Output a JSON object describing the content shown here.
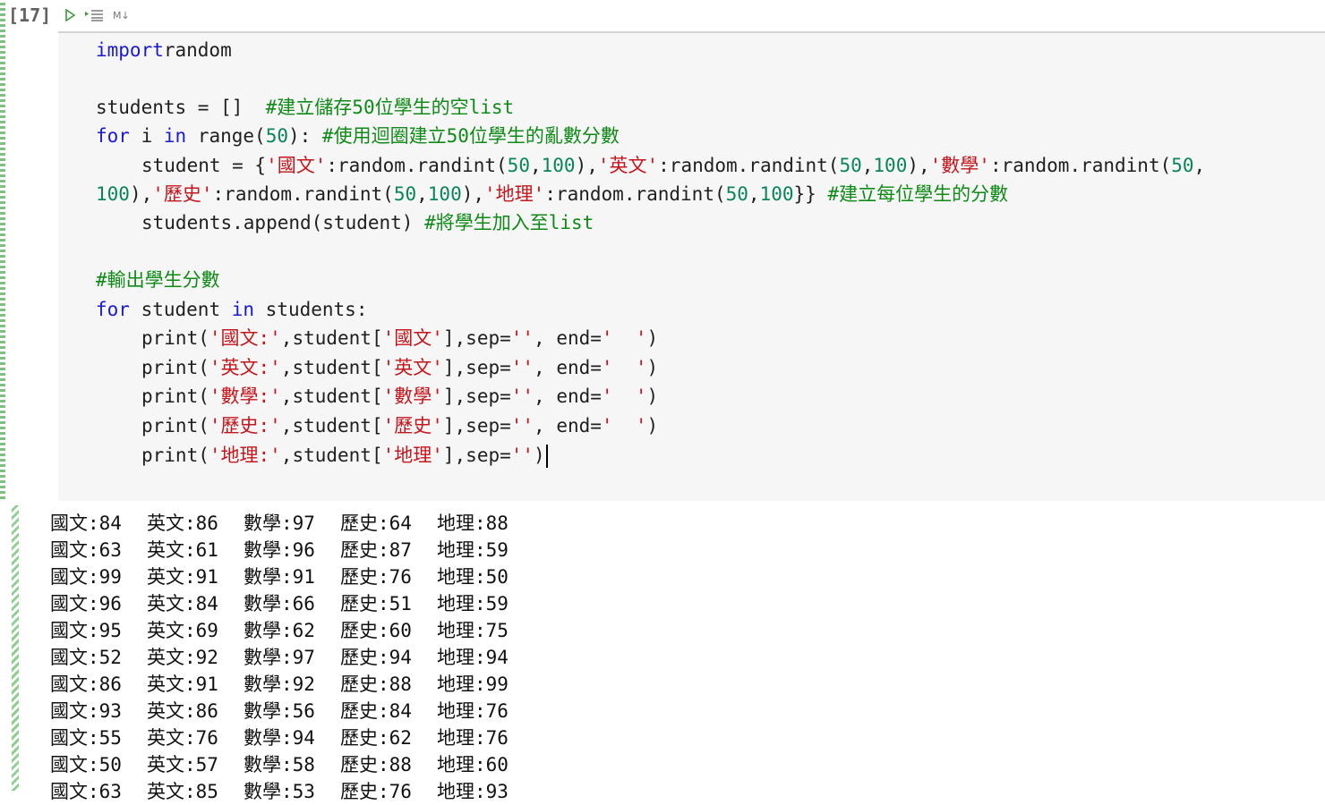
{
  "cell": {
    "execution_count": "[17]",
    "toolbar": {
      "run_icon": "run-cell-icon",
      "run_below_icon": "run-below-icon",
      "md_label": "M↓"
    }
  },
  "code_lines": [
    {
      "indent": 0,
      "tokens": [
        [
          "kw",
          "import"
        ],
        [
          "",
          "random"
        ]
      ]
    },
    {
      "indent": 0,
      "tokens": []
    },
    {
      "indent": 0,
      "tokens": [
        [
          "",
          "students = []  "
        ],
        [
          "cm",
          "#建立儲存50位學生的空list"
        ]
      ]
    },
    {
      "indent": 0,
      "tokens": [
        [
          "kw",
          "for"
        ],
        [
          "",
          " i "
        ],
        [
          "kw",
          "in"
        ],
        [
          "",
          " range("
        ],
        [
          "num",
          "50"
        ],
        [
          "",
          "): "
        ],
        [
          "cm",
          "#使用迴圈建立50位學生的亂數分數"
        ]
      ]
    },
    {
      "indent": 1,
      "tokens": [
        [
          "",
          "student = {"
        ],
        [
          "str",
          "'國文'"
        ],
        [
          "",
          ":random.randint("
        ],
        [
          "num",
          "50"
        ],
        [
          "",
          ","
        ],
        [
          "num",
          "100"
        ],
        [
          "",
          "),"
        ],
        [
          "str",
          "'英文'"
        ],
        [
          "",
          ":random.randint("
        ],
        [
          "num",
          "50"
        ],
        [
          "",
          ","
        ],
        [
          "num",
          "100"
        ],
        [
          "",
          "),"
        ],
        [
          "str",
          "'數學'"
        ],
        [
          "",
          ":random.randint("
        ],
        [
          "num",
          "50"
        ],
        [
          "",
          ","
        ]
      ]
    },
    {
      "indent": 0,
      "tokens": [
        [
          "num",
          "100"
        ],
        [
          "",
          "),"
        ],
        [
          "str",
          "'歷史'"
        ],
        [
          "",
          ":random.randint("
        ],
        [
          "num",
          "50"
        ],
        [
          "",
          ","
        ],
        [
          "num",
          "100"
        ],
        [
          "",
          "),"
        ],
        [
          "str",
          "'地理'"
        ],
        [
          "",
          ":random.randint("
        ],
        [
          "num",
          "50"
        ],
        [
          "",
          ","
        ],
        [
          "num",
          "100"
        ],
        [
          "",
          "}} "
        ],
        [
          "cm",
          "#建立每位學生的分數"
        ]
      ]
    },
    {
      "indent": 1,
      "tokens": [
        [
          "",
          "students.append(student) "
        ],
        [
          "cm",
          "#將學生加入至list"
        ]
      ]
    },
    {
      "indent": 0,
      "tokens": []
    },
    {
      "indent": 0,
      "tokens": [
        [
          "cm",
          "#輸出學生分數"
        ]
      ]
    },
    {
      "indent": 0,
      "tokens": [
        [
          "kw",
          "for"
        ],
        [
          "",
          " student "
        ],
        [
          "kw",
          "in"
        ],
        [
          "",
          " students:"
        ]
      ]
    },
    {
      "indent": 1,
      "tokens": [
        [
          "",
          "print("
        ],
        [
          "str",
          "'國文:'"
        ],
        [
          "",
          ",student["
        ],
        [
          "str",
          "'國文'"
        ],
        [
          "",
          "],sep="
        ],
        [
          "str",
          "''"
        ],
        [
          "",
          ", end="
        ],
        [
          "str",
          "'  '"
        ],
        [
          "",
          ")"
        ]
      ]
    },
    {
      "indent": 1,
      "tokens": [
        [
          "",
          "print("
        ],
        [
          "str",
          "'英文:'"
        ],
        [
          "",
          ",student["
        ],
        [
          "str",
          "'英文'"
        ],
        [
          "",
          "],sep="
        ],
        [
          "str",
          "''"
        ],
        [
          "",
          ", end="
        ],
        [
          "str",
          "'  '"
        ],
        [
          "",
          ")"
        ]
      ]
    },
    {
      "indent": 1,
      "tokens": [
        [
          "",
          "print("
        ],
        [
          "str",
          "'數學:'"
        ],
        [
          "",
          ",student["
        ],
        [
          "str",
          "'數學'"
        ],
        [
          "",
          "],sep="
        ],
        [
          "str",
          "''"
        ],
        [
          "",
          ", end="
        ],
        [
          "str",
          "'  '"
        ],
        [
          "",
          ")"
        ]
      ]
    },
    {
      "indent": 1,
      "tokens": [
        [
          "",
          "print("
        ],
        [
          "str",
          "'歷史:'"
        ],
        [
          "",
          ",student["
        ],
        [
          "str",
          "'歷史'"
        ],
        [
          "",
          "],sep="
        ],
        [
          "str",
          "''"
        ],
        [
          "",
          ", end="
        ],
        [
          "str",
          "'  '"
        ],
        [
          "",
          ")"
        ]
      ]
    },
    {
      "indent": 1,
      "tokens": [
        [
          "",
          "print("
        ],
        [
          "str",
          "'地理:'"
        ],
        [
          "",
          ",student["
        ],
        [
          "str",
          "'地理'"
        ],
        [
          "",
          "],sep="
        ],
        [
          "str",
          "''"
        ],
        [
          "",
          ")"
        ]
      ]
    }
  ],
  "output_rows": [
    [
      "國文:84",
      "英文:86",
      "數學:97",
      "歷史:64",
      "地理:88"
    ],
    [
      "國文:63",
      "英文:61",
      "數學:96",
      "歷史:87",
      "地理:59"
    ],
    [
      "國文:99",
      "英文:91",
      "數學:91",
      "歷史:76",
      "地理:50"
    ],
    [
      "國文:96",
      "英文:84",
      "數學:66",
      "歷史:51",
      "地理:59"
    ],
    [
      "國文:95",
      "英文:69",
      "數學:62",
      "歷史:60",
      "地理:75"
    ],
    [
      "國文:52",
      "英文:92",
      "數學:97",
      "歷史:94",
      "地理:94"
    ],
    [
      "國文:86",
      "英文:91",
      "數學:92",
      "歷史:88",
      "地理:99"
    ],
    [
      "國文:93",
      "英文:86",
      "數學:56",
      "歷史:84",
      "地理:76"
    ],
    [
      "國文:55",
      "英文:76",
      "數學:94",
      "歷史:62",
      "地理:76"
    ],
    [
      "國文:50",
      "英文:57",
      "數學:58",
      "歷史:88",
      "地理:60"
    ],
    [
      "國文:63",
      "英文:85",
      "數學:53",
      "歷史:76",
      "地理:93"
    ]
  ]
}
